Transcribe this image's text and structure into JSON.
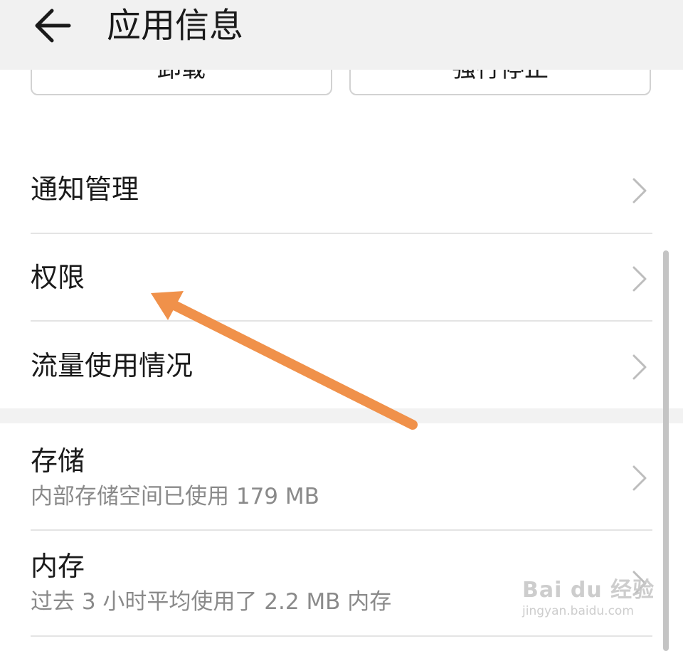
{
  "header": {
    "title": "应用信息",
    "back_icon": "arrow-left-icon"
  },
  "actions": {
    "uninstall_label": "卸载",
    "force_stop_label": "强行停止"
  },
  "list": {
    "notification": {
      "label": "通知管理"
    },
    "permissions": {
      "label": "权限"
    },
    "data_usage": {
      "label": "流量使用情况"
    },
    "storage": {
      "label": "存储",
      "detail": "内部存储空间已使用 179 MB"
    },
    "memory": {
      "label": "内存",
      "detail": "过去 3 小时平均使用了 2.2 MB 内存"
    }
  },
  "annotation": {
    "color": "#f0914a"
  },
  "watermark": {
    "brand": "Bai du 经验",
    "url": "jingyan.baidu.com"
  }
}
